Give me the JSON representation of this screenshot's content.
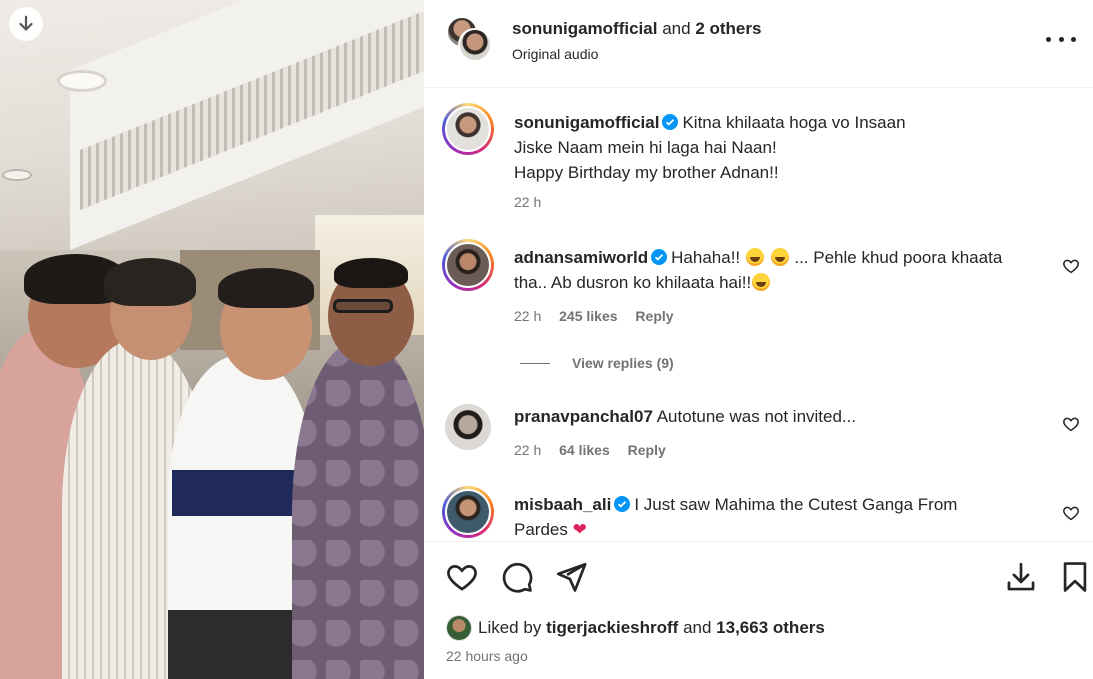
{
  "header": {
    "author": "sonunigamofficial",
    "and_text": "and",
    "others": "2 others",
    "audio": "Original audio"
  },
  "comments": [
    {
      "user": "sonunigamofficial",
      "lines": [
        "Kitna khilaata hoga vo Insaan",
        "Jiske Naam mein hi laga hai Naan!",
        "Happy Birthday my brother Adnan!!"
      ],
      "time": "22 h"
    },
    {
      "user": "adnansamiworld",
      "text_a": "Hahaha!!",
      "text_b": "... Pehle khud poora khaata",
      "text_c": "tha.. Ab dusron ko khilaata hai!!",
      "time": "22 h",
      "likes": "245 likes",
      "reply": "Reply",
      "view_replies": "View replies (9)"
    },
    {
      "user": "pranavpanchal07",
      "text": "Autotune was not invited...",
      "time": "22 h",
      "likes": "64 likes",
      "reply": "Reply"
    },
    {
      "user": "misbaah_ali",
      "text": "I Just saw Mahima the Cutest Ganga From",
      "text2": "Pardes",
      "heart": "❤"
    }
  ],
  "likes": {
    "prefix": "Liked by",
    "user": "tigerjackieshroff",
    "and_text": "and",
    "others": "13,663 others"
  },
  "posted": "22 hours ago",
  "colors": {
    "verified": "#0095f6",
    "muted": "#737373",
    "text": "#262626"
  }
}
